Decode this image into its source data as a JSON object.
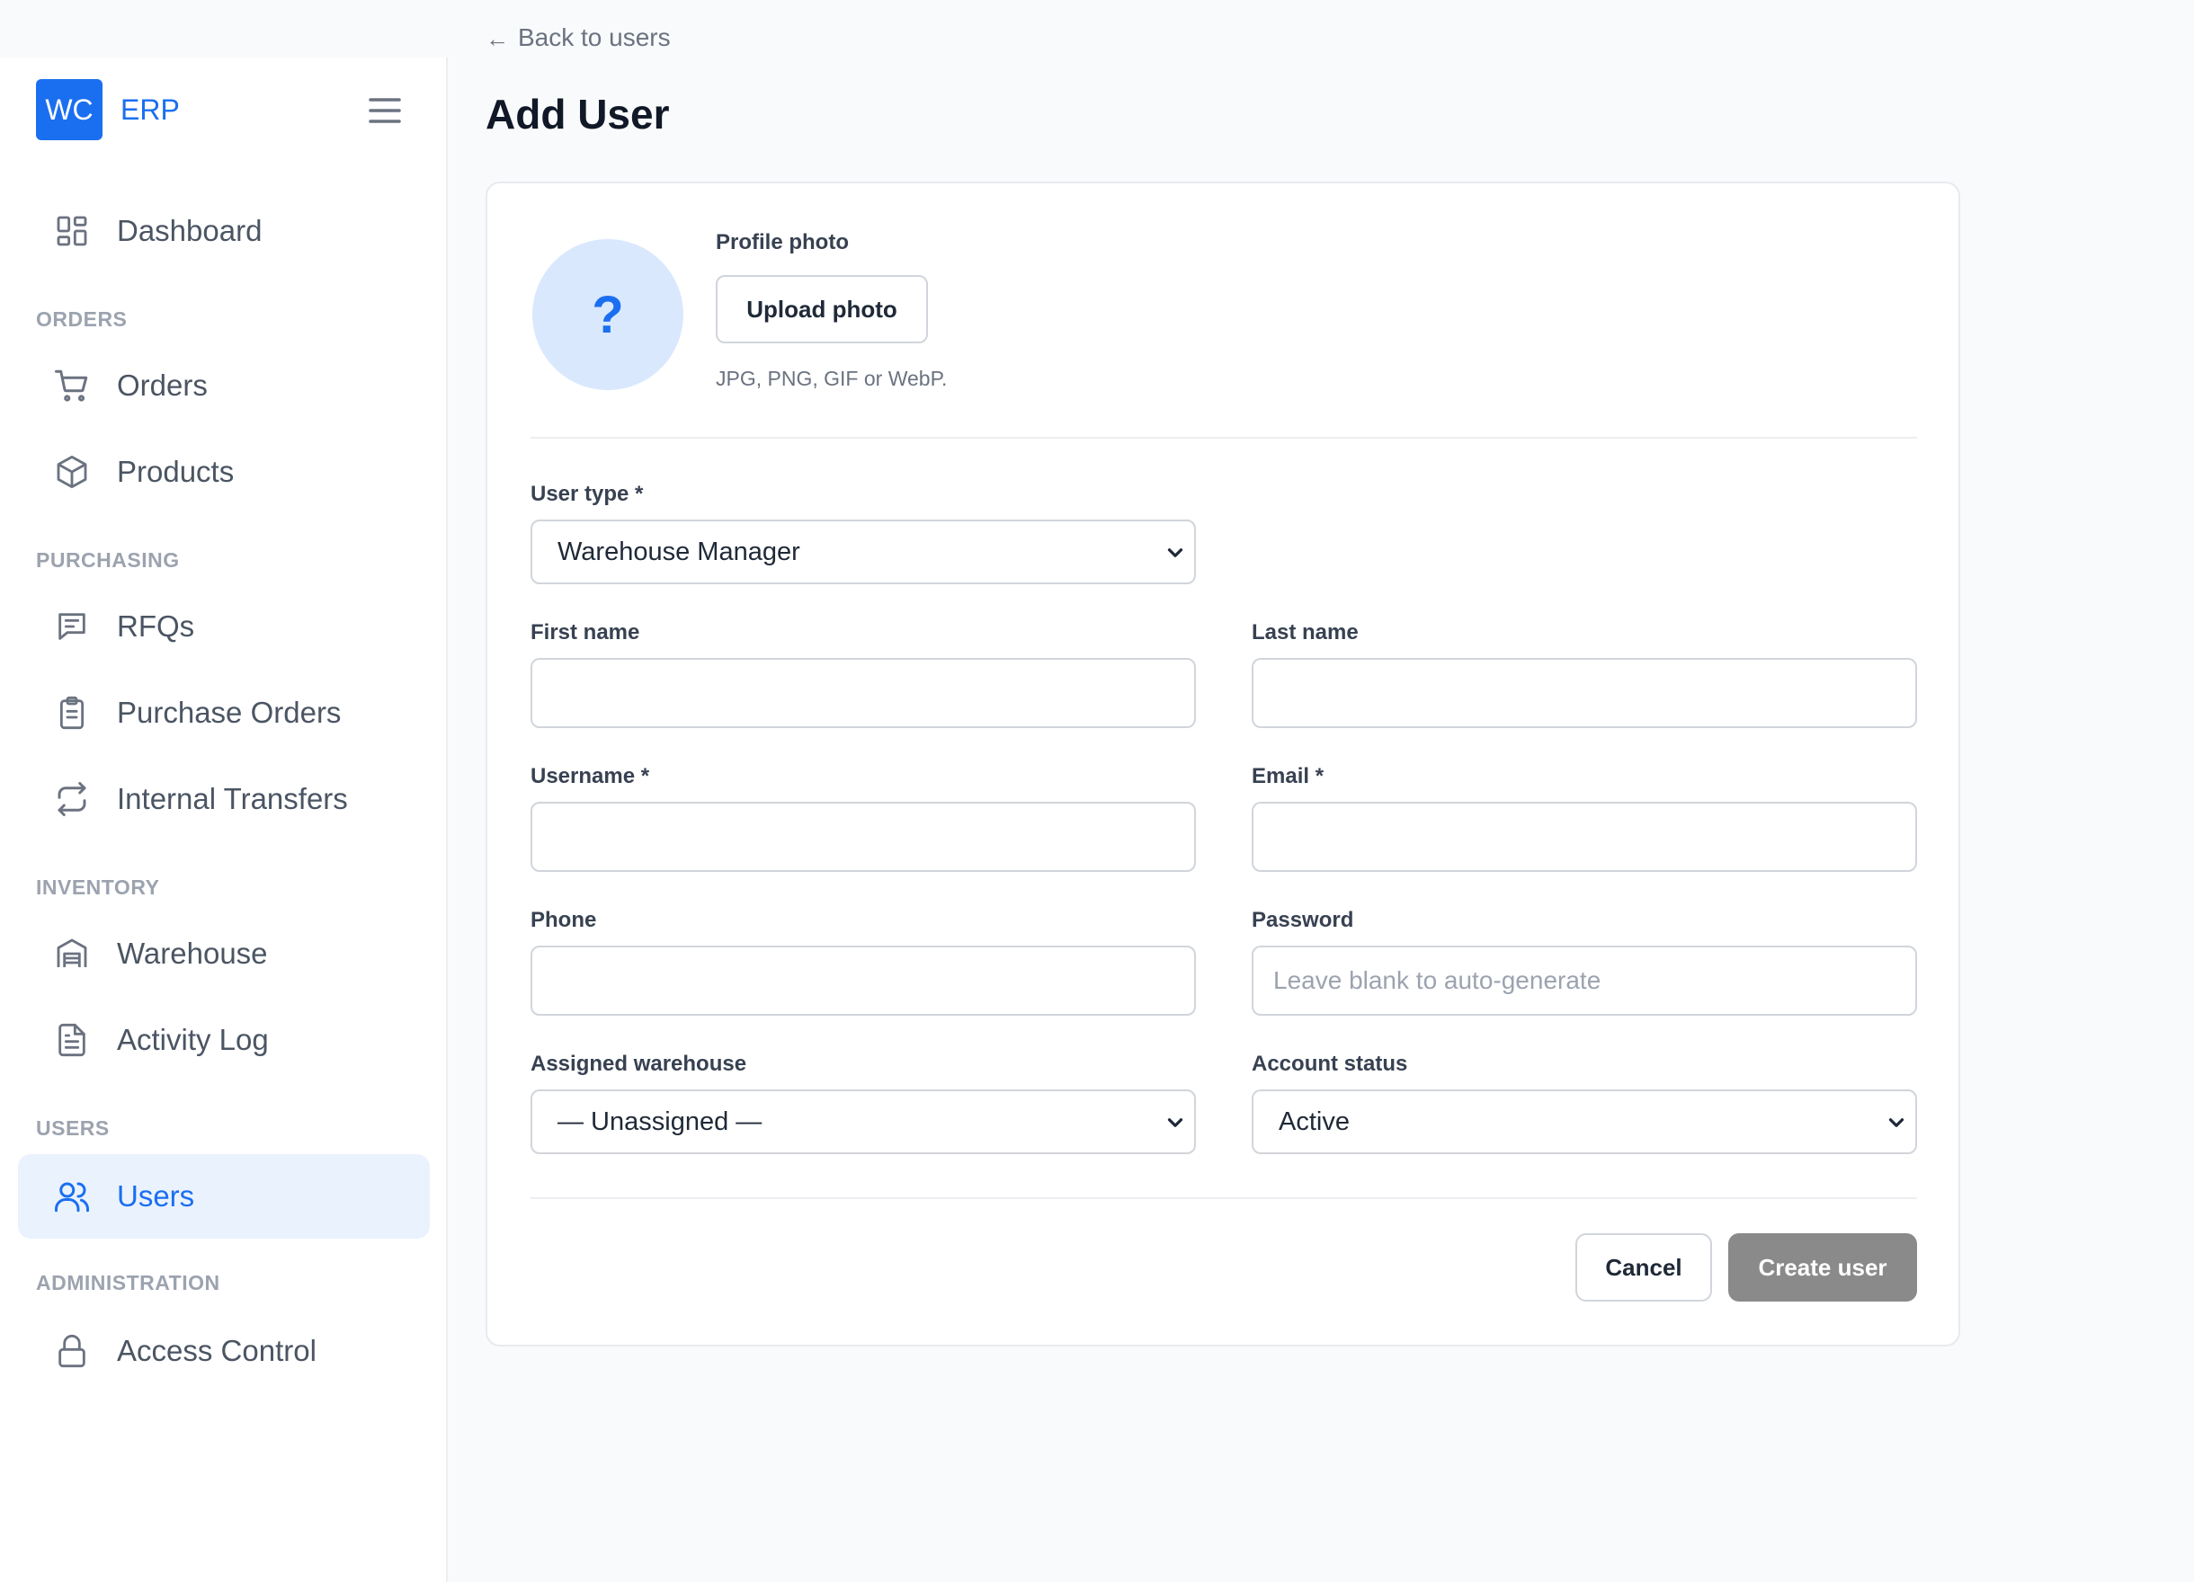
{
  "brand": {
    "logo": "WC",
    "name": "ERP"
  },
  "nav": {
    "dashboard": "Dashboard",
    "sections": {
      "orders": "ORDERS",
      "purchasing": "PURCHASING",
      "inventory": "INVENTORY",
      "users": "USERS",
      "administration": "ADMINISTRATION"
    },
    "items": {
      "orders": "Orders",
      "products": "Products",
      "rfqs": "RFQs",
      "purchase_orders": "Purchase Orders",
      "internal_transfers": "Internal Transfers",
      "warehouse": "Warehouse",
      "activity_log": "Activity Log",
      "users": "Users",
      "access_control": "Access Control"
    },
    "active": "Users"
  },
  "header": {
    "back_arrow": "←",
    "back_label": "Back to users",
    "title": "Add User"
  },
  "form": {
    "avatar_placeholder": "?",
    "photo_label": "Profile photo",
    "upload_label": "Upload photo",
    "photo_hint": "JPG, PNG, GIF or WebP.",
    "user_type": {
      "label": "User type *",
      "value": "Warehouse Manager"
    },
    "first_name": {
      "label": "First name",
      "value": ""
    },
    "last_name": {
      "label": "Last name",
      "value": ""
    },
    "username": {
      "label": "Username *",
      "value": ""
    },
    "email": {
      "label": "Email *",
      "value": ""
    },
    "phone": {
      "label": "Phone",
      "value": ""
    },
    "password": {
      "label": "Password",
      "value": "",
      "placeholder": "Leave blank to auto-generate"
    },
    "assigned_warehouse": {
      "label": "Assigned warehouse",
      "value": "— Unassigned —"
    },
    "account_status": {
      "label": "Account status",
      "value": "Active"
    },
    "cancel_label": "Cancel",
    "submit_label": "Create user"
  },
  "colors": {
    "accent": "#1a6ff0",
    "active_nav_bg": "#eaf2fe",
    "submit_disabled": "#8a8a8a"
  },
  "icons": {
    "menu": "hamburger-icon",
    "dashboard": "grid-icon",
    "orders": "cart-icon",
    "products": "box-icon",
    "rfqs": "message-icon",
    "purchase_orders": "clipboard-icon",
    "internal_transfers": "transfer-icon",
    "warehouse": "warehouse-icon",
    "activity_log": "file-text-icon",
    "users": "users-icon",
    "access_control": "lock-icon",
    "select": "chevron-down-icon"
  }
}
